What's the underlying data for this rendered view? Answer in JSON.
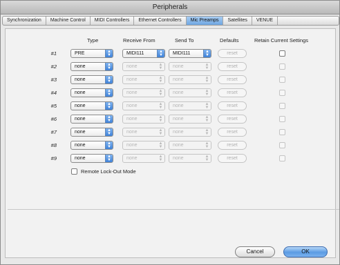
{
  "window": {
    "title": "Peripherals"
  },
  "tabs": [
    {
      "label": "Synchronization",
      "active": false
    },
    {
      "label": "Machine Control",
      "active": false
    },
    {
      "label": "MIDI Controllers",
      "active": false
    },
    {
      "label": "Ethernet Controllers",
      "active": false
    },
    {
      "label": "Mic Preamps",
      "active": true
    },
    {
      "label": "Satellites",
      "active": false
    },
    {
      "label": "VENUE",
      "active": false
    }
  ],
  "columns": {
    "type": "Type",
    "receive_from": "Receive From",
    "send_to": "Send To",
    "defaults": "Defaults",
    "retain": "Retain Current Settings"
  },
  "rows": [
    {
      "num": "#1",
      "type": "PRE",
      "receive": "MIDI111",
      "send": "MIDI111",
      "reset": "reset"
    },
    {
      "num": "#2",
      "type": "none",
      "receive": "none",
      "send": "none",
      "reset": "reset"
    },
    {
      "num": "#3",
      "type": "none",
      "receive": "none",
      "send": "none",
      "reset": "reset"
    },
    {
      "num": "#4",
      "type": "none",
      "receive": "none",
      "send": "none",
      "reset": "reset"
    },
    {
      "num": "#5",
      "type": "none",
      "receive": "none",
      "send": "none",
      "reset": "reset"
    },
    {
      "num": "#6",
      "type": "none",
      "receive": "none",
      "send": "none",
      "reset": "reset"
    },
    {
      "num": "#7",
      "type": "none",
      "receive": "none",
      "send": "none",
      "reset": "reset"
    },
    {
      "num": "#8",
      "type": "none",
      "receive": "none",
      "send": "none",
      "reset": "reset"
    },
    {
      "num": "#9",
      "type": "none",
      "receive": "none",
      "send": "none",
      "reset": "reset"
    }
  ],
  "lockout": {
    "label": "Remote Lock-Out Mode",
    "checked": false
  },
  "buttons": {
    "cancel": "Cancel",
    "ok": "OK"
  },
  "colors": {
    "accent": "#5b9be3",
    "window_bg": "#e8e8e8"
  }
}
